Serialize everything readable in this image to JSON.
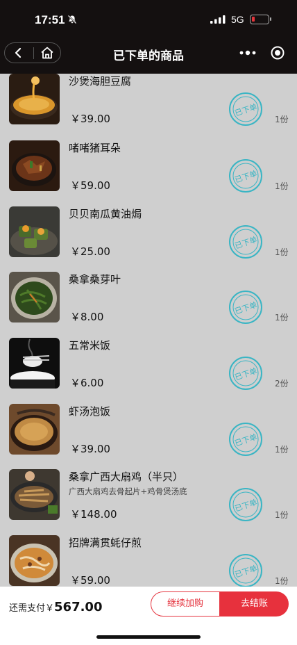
{
  "status": {
    "time": "17:51",
    "network": "5G"
  },
  "nav": {
    "title": "已下单的商品"
  },
  "items": [
    {
      "name": "沙煲海胆豆腐",
      "price": "￥39.00",
      "qty": "1份",
      "stamp": "已下单",
      "thumb": "seafood-tofu-pot"
    },
    {
      "name": "啫啫猪耳朵",
      "price": "￥59.00",
      "qty": "1份",
      "stamp": "已下单",
      "thumb": "pork-ear-claypot"
    },
    {
      "name": "贝贝南瓜黄油焗",
      "price": "￥25.00",
      "qty": "1份",
      "stamp": "已下单",
      "thumb": "baked-pumpkin"
    },
    {
      "name": "桑拿桑芽叶",
      "price": "￥8.00",
      "qty": "1份",
      "stamp": "已下单",
      "thumb": "mulberry-greens"
    },
    {
      "name": "五常米饭",
      "price": "￥6.00",
      "qty": "2份",
      "stamp": "已下单",
      "thumb": "steamed-rice"
    },
    {
      "name": "虾汤泡饭",
      "price": "￥39.00",
      "qty": "1份",
      "stamp": "已下单",
      "thumb": "shrimp-soup-rice"
    },
    {
      "name": "桑拿广西大扇鸡（半只）",
      "sub": "广西大扇鸡去骨起片+鸡骨煲汤底",
      "price": "￥148.00",
      "qty": "1份",
      "stamp": "已下单",
      "thumb": "sauna-chicken"
    },
    {
      "name": "招牌满贯蚝仔煎",
      "price": "￥59.00",
      "qty": "1份",
      "stamp": "已下单",
      "thumb": "oyster-omelette"
    }
  ],
  "footer": {
    "total_label": "还需支付￥",
    "total_amount": "567.00",
    "add_label": "继续加购",
    "pay_label": "去结账"
  },
  "colors": {
    "accent": "#e7313d",
    "stamp": "#39b5c4",
    "header": "#141010"
  }
}
